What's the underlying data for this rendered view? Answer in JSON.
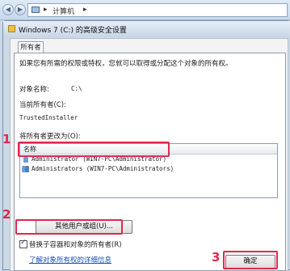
{
  "explorer": {
    "back": "◀",
    "forward": "▶",
    "separator": "▸",
    "crumb": "计算机",
    "separator2": "▸"
  },
  "dialog": {
    "title": "Windows 7 (C:) 的高级安全设置",
    "tab": "所有者",
    "intro": "如果您有所需的权限或特权，您就可以取得或分配这个对象的所有权。",
    "object_name_label": "对象名称:",
    "object_name_value": "C:\\",
    "current_owner_label": "当前所有者(C):",
    "current_owner_value": "TrustedInstaller",
    "change_owner_label": "将所有者更改为(O):",
    "list_header": "名称",
    "owners": [
      "Administrator (WIN7-PC\\Administrator)",
      "Administrators (WIN7-PC\\Administrators)"
    ],
    "other_users_button": "其他用户或组(U)...",
    "replace_checkbox_label": "替换子容器和对象的所有者(R)",
    "help_link": "了解对象所有权的详细信息",
    "ok_button": "确定"
  },
  "markers": [
    "1",
    "2",
    "3"
  ],
  "colors": {
    "annotation": "#e0284f"
  }
}
